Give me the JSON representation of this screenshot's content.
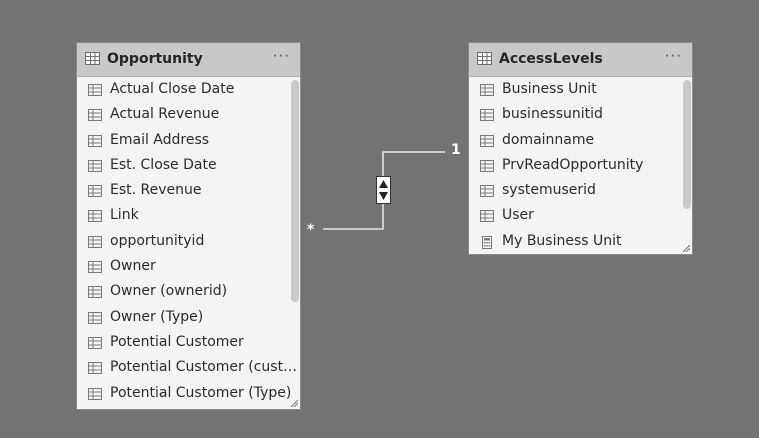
{
  "tables": [
    {
      "title": "Opportunity",
      "more_label": "···",
      "fields": [
        {
          "label": "Actual Close Date",
          "icon": "table-column-icon"
        },
        {
          "label": "Actual Revenue",
          "icon": "table-column-icon"
        },
        {
          "label": "Email Address",
          "icon": "table-column-icon"
        },
        {
          "label": "Est. Close Date",
          "icon": "table-column-icon"
        },
        {
          "label": "Est. Revenue",
          "icon": "table-column-icon"
        },
        {
          "label": "Link",
          "icon": "table-column-icon"
        },
        {
          "label": "opportunityid",
          "icon": "table-column-icon"
        },
        {
          "label": "Owner",
          "icon": "table-column-icon"
        },
        {
          "label": "Owner (ownerid)",
          "icon": "table-column-icon"
        },
        {
          "label": "Owner (Type)",
          "icon": "table-column-icon"
        },
        {
          "label": "Potential Customer",
          "icon": "table-column-icon"
        },
        {
          "label": "Potential Customer (cust…",
          "icon": "table-column-icon"
        },
        {
          "label": "Potential Customer (Type)",
          "icon": "table-column-icon"
        }
      ]
    },
    {
      "title": "AccessLevels",
      "more_label": "···",
      "fields": [
        {
          "label": "Business Unit",
          "icon": "table-column-icon"
        },
        {
          "label": "businessunitid",
          "icon": "table-column-icon"
        },
        {
          "label": "domainname",
          "icon": "table-column-icon"
        },
        {
          "label": "PrvReadOpportunity",
          "icon": "table-column-icon"
        },
        {
          "label": "systemuserid",
          "icon": "table-column-icon"
        },
        {
          "label": "User",
          "icon": "table-column-icon"
        },
        {
          "label": "My Business Unit",
          "icon": "calculator-measure-icon"
        }
      ]
    }
  ],
  "relationship": {
    "many_side": "*",
    "one_side": "1",
    "cross_filter": "both-directions-arrows-icon"
  },
  "colors": {
    "canvas": "#737373",
    "card_body": "#f4f4f4",
    "card_header": "#c8c8c8",
    "line": "#ffffff"
  }
}
